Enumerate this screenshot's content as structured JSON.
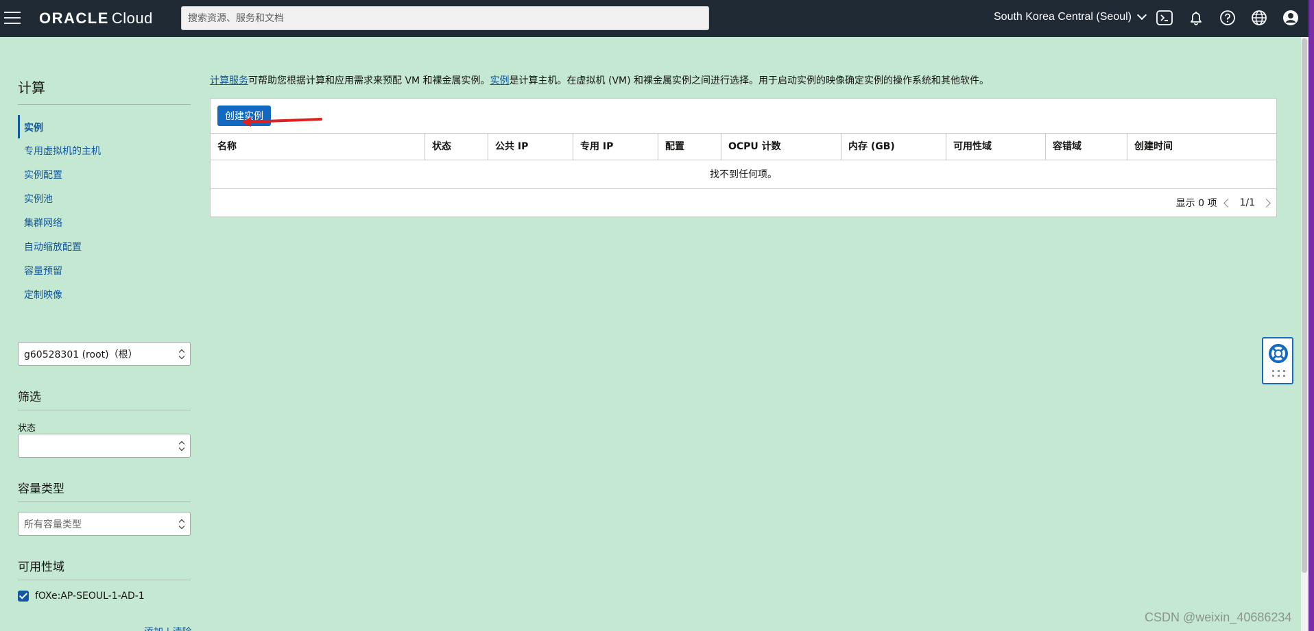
{
  "topbar": {
    "logo_brand": "ORACLE",
    "logo_product": "Cloud",
    "search_placeholder": "搜索资源、服务和文档",
    "region": "South Korea Central (Seoul)",
    "icons": [
      "menu-icon",
      "cloud-shell-icon",
      "bell-icon",
      "help-icon",
      "globe-icon",
      "user-icon"
    ]
  },
  "sidebar": {
    "title": "计算",
    "items": [
      {
        "label": "实例",
        "active": true
      },
      {
        "label": "专用虚拟机的主机"
      },
      {
        "label": "实例配置"
      },
      {
        "label": "实例池"
      },
      {
        "label": "集群网络"
      },
      {
        "label": "自动缩放配置"
      },
      {
        "label": "容量预留"
      },
      {
        "label": "定制映像"
      }
    ],
    "compartment": "g60528301 (root)（根）",
    "filter_title": "筛选",
    "state_label": "状态",
    "state_value": "",
    "capacity_title": "容量类型",
    "capacity_placeholder": "所有容量类型",
    "ad_title": "可用性域",
    "ad_option": "fOXe:AP-SEOUL-1-AD-1",
    "ad_checked": true,
    "add_clear": "添加 | 清除"
  },
  "main": {
    "intro_link1": "计算服务",
    "intro_text1": "可帮助您根据计算和应用需求来预配 VM 和裸金属实例。",
    "intro_link2": "实例",
    "intro_text2": "是计算主机。在虚拟机 (VM) 和裸金属实例之间进行选择。用于启动实例的映像确定实例的操作系统和其他软件。",
    "create_button": "创建实例",
    "columns": [
      "名称",
      "状态",
      "公共 IP",
      "专用 IP",
      "配置",
      "OCPU 计数",
      "内存 (GB)",
      "可用性域",
      "容错域",
      "创建时间"
    ],
    "empty_message": "找不到任何项。",
    "showing": "显示 0 项",
    "page": "1/1"
  },
  "colors": {
    "topbar_bg": "#1f2a35",
    "page_bg": "#c5e8d2",
    "link": "#1257a0",
    "primary_button": "#1369c1",
    "annotation_arrow": "#e02020"
  },
  "watermark": "CSDN @weixin_40686234"
}
